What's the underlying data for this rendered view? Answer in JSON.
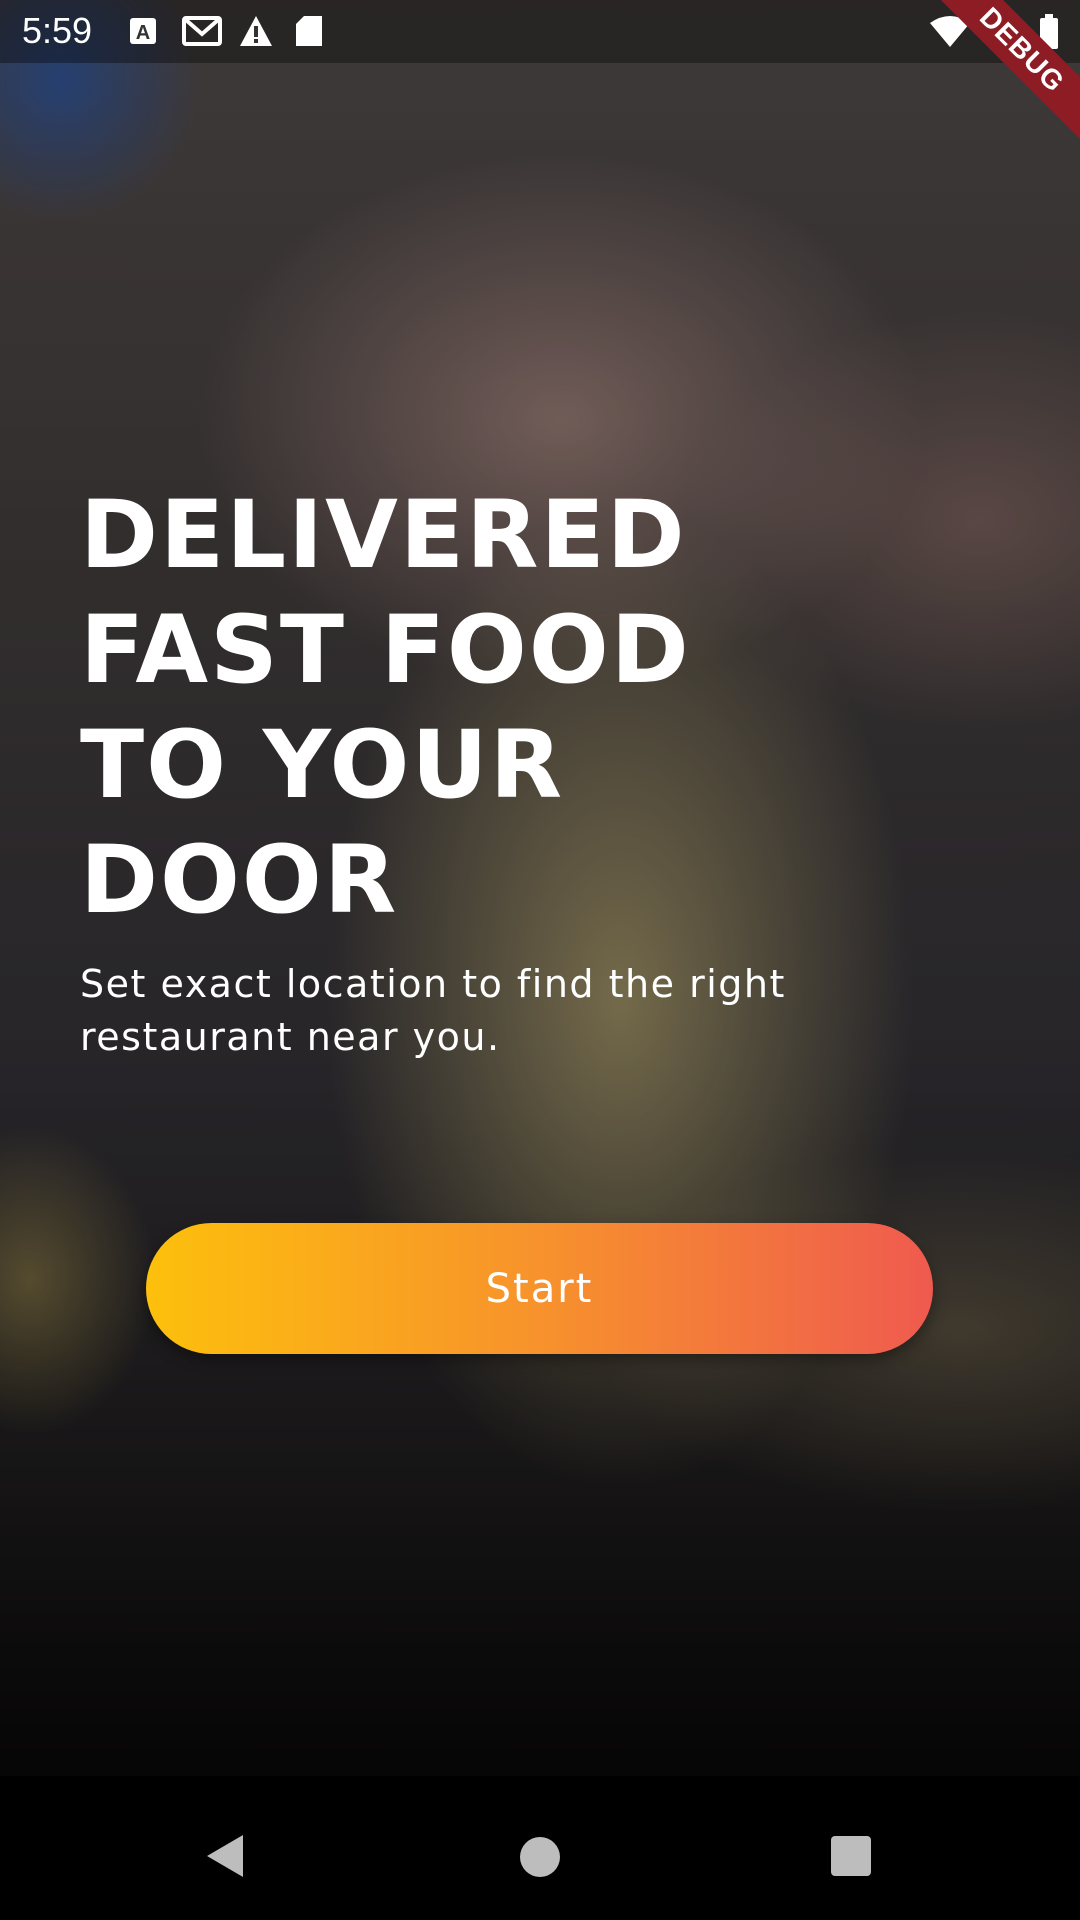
{
  "status_bar": {
    "time": "5:59",
    "left_icons": [
      "text-a-icon",
      "gmail-icon",
      "warning-icon",
      "sd-card-icon"
    ],
    "right_icons": [
      "wifi-icon",
      "signal-icon",
      "battery-icon"
    ]
  },
  "debug_banner": "DEBUG",
  "hero": {
    "headline_lines": [
      "DELIVERED",
      "FAST FOOD",
      "TO YOUR",
      "DOOR"
    ],
    "subtitle_lines": [
      "Set exact location to find the right",
      "restaurant near you."
    ]
  },
  "start_button": {
    "label": "Start",
    "gradient": [
      "#fdc00c",
      "#f7922c",
      "#ef5a4f"
    ]
  },
  "nav_bar": {
    "buttons": [
      "back-icon",
      "home-icon",
      "recents-icon"
    ]
  }
}
